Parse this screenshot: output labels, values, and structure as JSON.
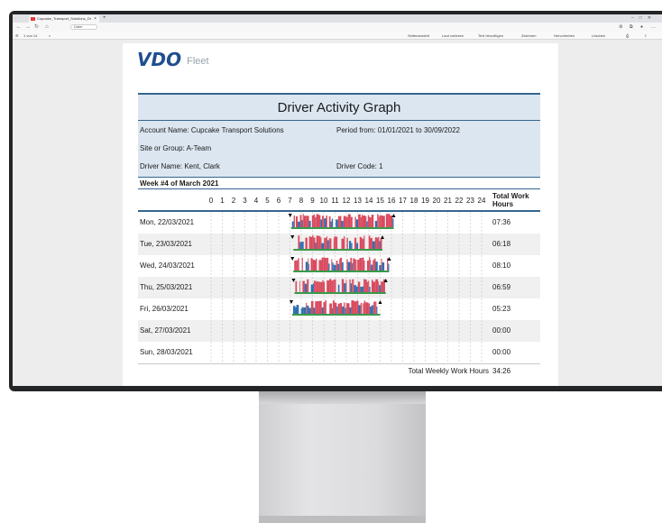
{
  "browser": {
    "tab_title": "Cupcake_Transport_Solutions_Dr",
    "url_text": "Datei",
    "page_box": "von 14",
    "pdf_toolbar": [
      "Seitenansicht",
      "Laut vorlesen",
      "Text hinzufügen",
      "Zeichnen",
      "Hervorheben",
      "Löschen"
    ]
  },
  "logo": {
    "brand": "VDO",
    "product": "Fleet"
  },
  "report": {
    "title": "Driver Activity Graph",
    "account": "Account Name: Cupcake Transport Solutions",
    "period": "Period from: 01/01/2021 to 30/09/2022",
    "site": "Site or Group: A-Team",
    "driver": "Driver Name: Kent, Clark",
    "driver_code": "Driver Code: 1",
    "week": "Week #4 of March 2021",
    "total_header_1": "Total Work",
    "total_header_2": "Hours",
    "hours": [
      "0",
      "1",
      "2",
      "3",
      "4",
      "5",
      "6",
      "7",
      "8",
      "9",
      "10",
      "11",
      "12",
      "13",
      "14",
      "15",
      "16",
      "17",
      "18",
      "19",
      "20",
      "21",
      "22",
      "23",
      "24"
    ],
    "days": [
      {
        "label": "Mon, 22/03/2021",
        "total": "07:36",
        "start": 7.1,
        "end": 16.2
      },
      {
        "label": "Tue, 23/03/2021",
        "total": "06:18",
        "start": 7.3,
        "end": 15.2
      },
      {
        "label": "Wed, 24/03/2021",
        "total": "08:10",
        "start": 7.3,
        "end": 15.8
      },
      {
        "label": "Thu, 25/03/2021",
        "total": "06:59",
        "start": 7.4,
        "end": 15.5
      },
      {
        "label": "Fri, 26/03/2021",
        "total": "05:23",
        "start": 7.2,
        "end": 15.0
      },
      {
        "label": "Sat, 27/03/2021",
        "total": "00:00"
      },
      {
        "label": "Sun, 28/03/2021",
        "total": "00:00"
      }
    ],
    "footer_label": "Total Weekly Work Hours",
    "footer_value": "34:26",
    "colors": {
      "work": "#d94a5e",
      "drive": "#2f6fb0",
      "rest": "#3a9a4a",
      "header": "#dbe6f0",
      "rule": "#35668f"
    }
  }
}
